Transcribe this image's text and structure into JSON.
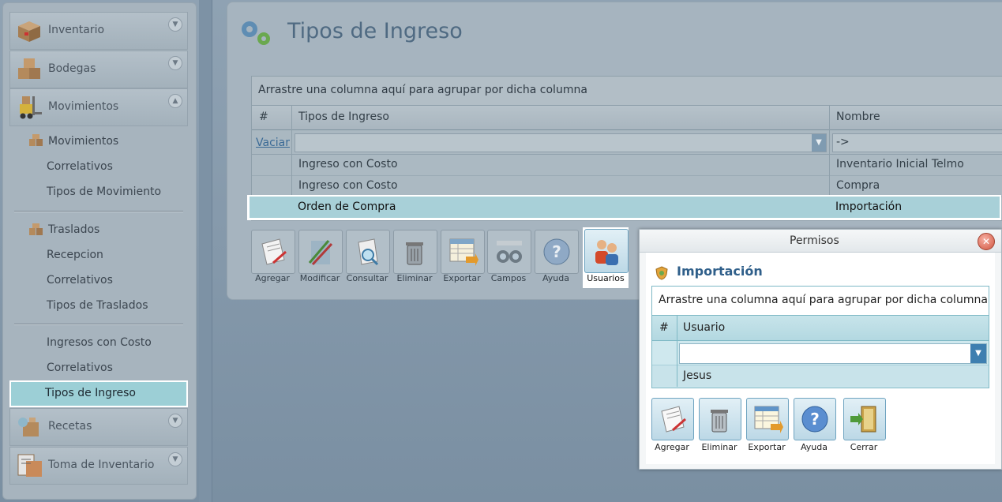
{
  "sidebar": {
    "sections": [
      {
        "label": "Inventario"
      },
      {
        "label": "Bodegas"
      },
      {
        "label": "Movimientos"
      }
    ],
    "movimientos_group": "Movimientos",
    "movimientos_items": [
      "Correlativos",
      "Tipos de Movimiento"
    ],
    "traslados_group": "Traslados",
    "traslados_items": [
      "Recepcion",
      "Correlativos",
      "Tipos de Traslados"
    ],
    "ingresos_items": [
      "Ingresos con Costo",
      "Correlativos"
    ],
    "selected_item": "Tipos de Ingreso",
    "bottom_sections": [
      {
        "label": "Recetas"
      },
      {
        "label": "Toma de Inventario"
      }
    ]
  },
  "main": {
    "title": "Tipos de Ingreso",
    "grid": {
      "group_hint": "Arrastre una columna aquí para agrupar por dicha columna",
      "columns": [
        "#",
        "Tipos de Ingreso",
        "Nombre"
      ],
      "filter_link": "Vaciar",
      "filter_nombre": "->",
      "rows": [
        {
          "tipo": "Ingreso con Costo",
          "nombre": "Inventario Inicial Telmo"
        },
        {
          "tipo": "Ingreso con Costo",
          "nombre": "Compra"
        },
        {
          "tipo": "Orden de Compra",
          "nombre": "Importación"
        }
      ]
    },
    "toolbar": [
      "Agregar",
      "Modificar",
      "Consultar",
      "Eliminar",
      "Exportar",
      "Campos",
      "Ayuda",
      "Usuarios"
    ]
  },
  "dialog": {
    "title": "Permisos",
    "subtitle": "Importación",
    "group_hint": "Arrastre una columna aquí para agrupar por dicha columna",
    "columns": [
      "#",
      "Usuario"
    ],
    "rows": [
      {
        "usuario": "Jesus"
      }
    ],
    "toolbar": [
      "Agregar",
      "Eliminar",
      "Exportar",
      "Ayuda",
      "Cerrar"
    ]
  },
  "colors": {
    "selection": "#a8d0d8",
    "title": "#4f6a82",
    "dialog_accent": "#2f5f8a"
  }
}
